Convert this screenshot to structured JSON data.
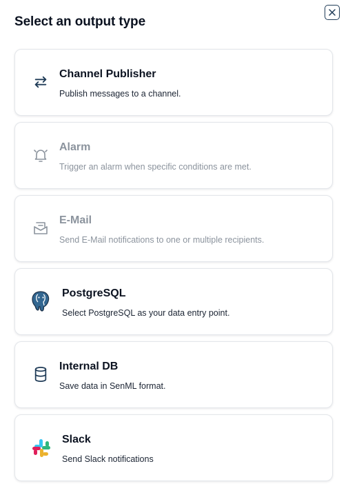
{
  "dialog": {
    "title": "Select an output type"
  },
  "options": [
    {
      "name": "Channel Publisher",
      "description": "Publish messages to a channel.",
      "icon": "swap-arrows-icon",
      "enabled": true
    },
    {
      "name": "Alarm",
      "description": "Trigger an alarm when specific conditions are met.",
      "icon": "bell-ring-icon",
      "enabled": false
    },
    {
      "name": "E-Mail",
      "description": "Send E-Mail notifications to one or multiple recipients.",
      "icon": "mail-open-icon",
      "enabled": false
    },
    {
      "name": "PostgreSQL",
      "description": "Select PostgreSQL as your data entry point.",
      "icon": "postgresql-logo-icon",
      "enabled": true
    },
    {
      "name": "Internal DB",
      "description": "Save data in SenML format.",
      "icon": "database-icon",
      "enabled": true
    },
    {
      "name": "Slack",
      "description": "Send Slack notifications",
      "icon": "slack-logo-icon",
      "enabled": true
    }
  ],
  "colors": {
    "text": "#0b1220",
    "disabled_text": "#8b939d",
    "icon_navy": "#1f3b57",
    "border": "#e3e6ea"
  }
}
